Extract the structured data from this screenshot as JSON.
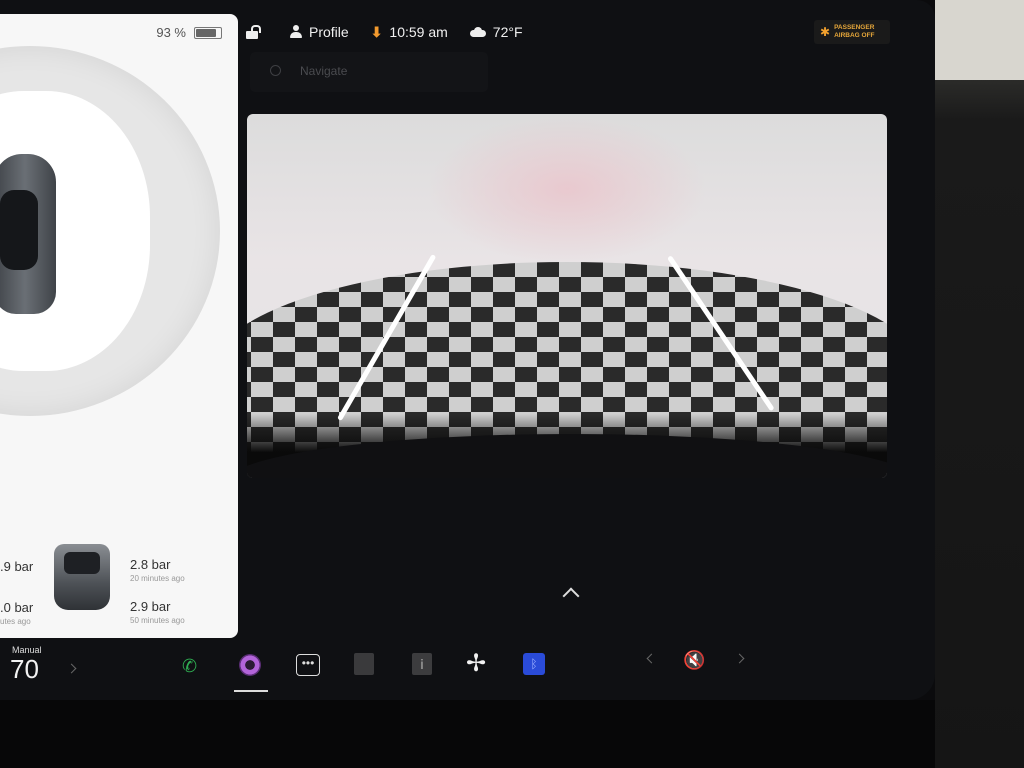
{
  "status_bar": {
    "battery_percent": "93 %",
    "battery_level": 0.93,
    "profile_label": "Profile",
    "time": "10:59 am",
    "temperature": "72°F",
    "airbag_line1": "PASSENGER",
    "airbag_line2": "AIRBAG OFF"
  },
  "navigate": {
    "placeholder": "Navigate"
  },
  "tires": {
    "front_left": {
      "value": ".9 bar",
      "ago": ""
    },
    "front_right": {
      "value": "2.8 bar",
      "ago": "20 minutes ago"
    },
    "rear_left": {
      "value": ".0 bar",
      "ago": "utes ago"
    },
    "rear_right": {
      "value": "2.9 bar",
      "ago": "50 minutes ago"
    }
  },
  "dock": {
    "speed_mode": "Manual",
    "speed": "70",
    "icons": [
      "phone-icon",
      "camera-icon",
      "more-icon",
      "grid-icon",
      "info-icon",
      "fan-icon",
      "bluetooth-icon",
      "mute-icon"
    ]
  },
  "colors": {
    "accent_orange": "#f29a2e",
    "phone_green": "#2fae52",
    "bluetooth_blue": "#2a4bd8",
    "camera_purple": "#b264d8"
  }
}
